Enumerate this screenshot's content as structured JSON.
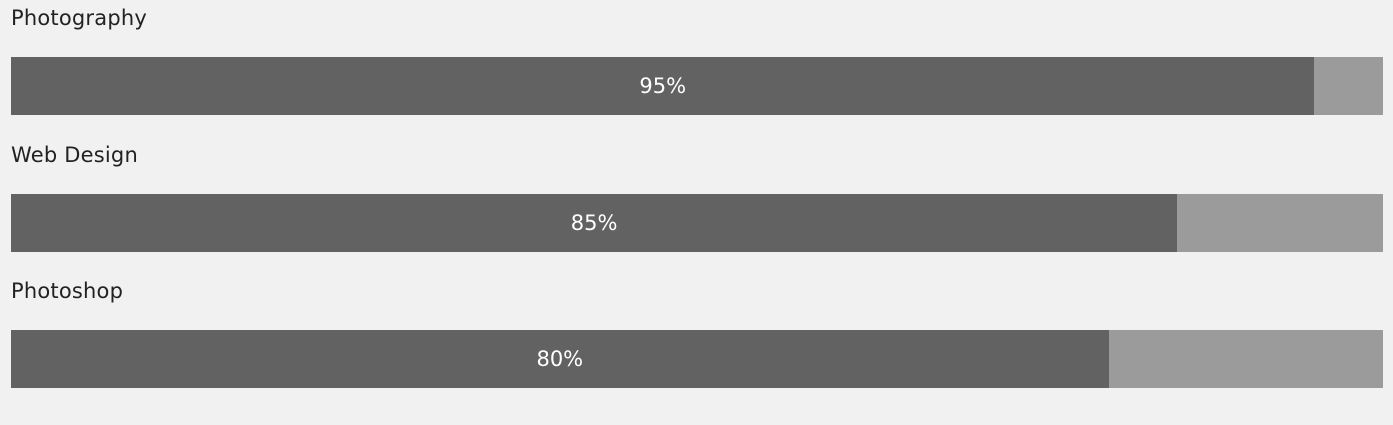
{
  "colors": {
    "background": "#f1f1f1",
    "bar_fill": "#626262",
    "bar_track": "#9b9b9b",
    "label_text": "#222222",
    "value_text": "#ffffff"
  },
  "skills": [
    {
      "label": "Photography",
      "percent": 95,
      "value_text": "95%"
    },
    {
      "label": "Web Design",
      "percent": 85,
      "value_text": "85%"
    },
    {
      "label": "Photoshop",
      "percent": 80,
      "value_text": "80%"
    }
  ]
}
